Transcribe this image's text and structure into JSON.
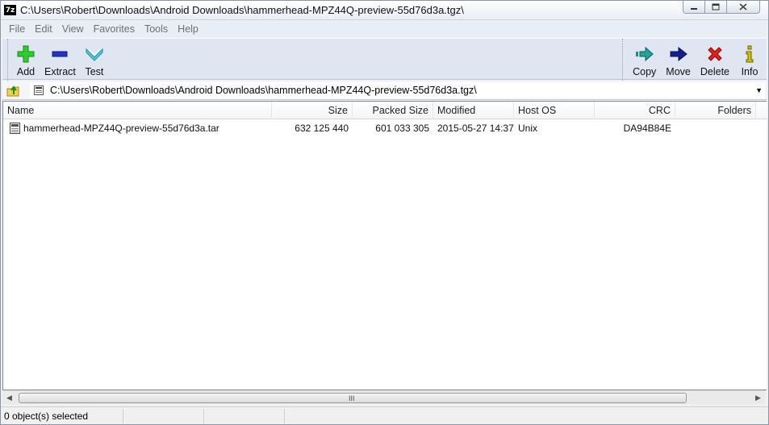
{
  "window": {
    "title": "C:\\Users\\Robert\\Downloads\\Android Downloads\\hammerhead-MPZ44Q-preview-55d76d3a.tgz\\",
    "app_icon": "7z",
    "controls": [
      "minimize-icon",
      "maximize-icon",
      "close-icon"
    ]
  },
  "menu": [
    "File",
    "Edit",
    "View",
    "Favorites",
    "Tools",
    "Help"
  ],
  "toolbar": {
    "left": [
      {
        "label": "Add",
        "icon": "plus-icon",
        "color": "#22b522"
      },
      {
        "label": "Extract",
        "icon": "minus-icon",
        "color": "#1a2fb8"
      },
      {
        "label": "Test",
        "icon": "check-chevron-icon",
        "color": "#3bb7c9"
      }
    ],
    "right": [
      {
        "label": "Copy",
        "icon": "arrow-right-icon",
        "color": "#1c8f8a"
      },
      {
        "label": "Move",
        "icon": "arrow-right-icon",
        "color": "#101a7a"
      },
      {
        "label": "Delete",
        "icon": "x-icon",
        "color": "#d61a1a"
      },
      {
        "label": "Info",
        "icon": "info-icon",
        "color": "#c6b400"
      }
    ]
  },
  "address": {
    "path": "C:\\Users\\Robert\\Downloads\\Android Downloads\\hammerhead-MPZ44Q-preview-55d76d3a.tgz\\"
  },
  "columns": [
    "Name",
    "Size",
    "Packed Size",
    "Modified",
    "Host OS",
    "CRC",
    "Folders"
  ],
  "rows": [
    {
      "name": "hammerhead-MPZ44Q-preview-55d76d3a.tar",
      "size": "632 125 440",
      "packed_size": "601 033 305",
      "modified": "2015-05-27 14:37",
      "host_os": "Unix",
      "crc": "DA94B84E",
      "folders": ""
    }
  ],
  "scrollbar": {
    "grip": "III"
  },
  "status": {
    "selection": "0 object(s) selected"
  }
}
